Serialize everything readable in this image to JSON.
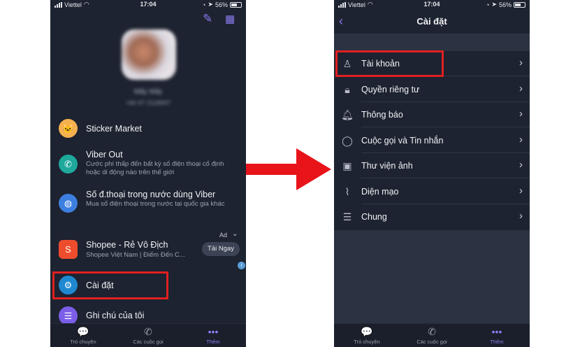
{
  "left_screen": {
    "status": {
      "carrier": "Viettel",
      "time": "17:04",
      "battery": "56%"
    },
    "blurred_name": "Mấy Mấy",
    "blurred_phone": "+84 97 2118997",
    "menu": [
      {
        "title": "Sticker Market",
        "subtitle": "",
        "icon": "cat-face-icon",
        "color": "#f5b14f"
      },
      {
        "title": "Viber Out",
        "subtitle": "Cước phí thấp đến bất kỳ số điện thoại cố định hoặc di động nào trên thế giới",
        "icon": "phone-out-icon",
        "color": "#1fa89c"
      },
      {
        "title": "Số đ.thoại trong nước dùng Viber",
        "subtitle": "Mua số điện thoại trong nước tại quốc gia khác",
        "icon": "globe-icon",
        "color": "#3d7fe0"
      }
    ],
    "ad": {
      "label": "Ad",
      "title": "Shopee - Rẻ Vô Địch",
      "subtitle": "Shopee Việt Nam | Điểm Đến C...",
      "cta": "Tải Ngay",
      "color": "#ee4d2d"
    },
    "settings_item": {
      "title": "Cài đặt",
      "icon": "gear-icon",
      "color": "#1e88d0"
    },
    "notes_item": {
      "title": "Ghi chú của tôi",
      "icon": "checklist-icon",
      "color": "#7b5ee8"
    },
    "tabs": [
      {
        "label": "Trò chuyện",
        "icon": "chat-bubble-icon"
      },
      {
        "label": "Các cuộc gọi",
        "icon": "phone-icon"
      },
      {
        "label": "Thêm",
        "icon": "more-dots-icon"
      }
    ]
  },
  "right_screen": {
    "status": {
      "carrier": "Viettel",
      "time": "17:04",
      "battery": "56%"
    },
    "title": "Cài đặt",
    "items": [
      {
        "label": "Tài khoản",
        "icon": "user-icon"
      },
      {
        "label": "Quyền riêng tư",
        "icon": "lock-icon"
      },
      {
        "label": "Thông báo",
        "icon": "bell-icon"
      },
      {
        "label": "Cuộc gọi và Tin nhắn",
        "icon": "chat-bubble-icon"
      },
      {
        "label": "Thư viện ảnh",
        "icon": "image-icon"
      },
      {
        "label": "Diện mạo",
        "icon": "brush-icon"
      },
      {
        "label": "Chung",
        "icon": "list-icon"
      }
    ],
    "tabs": [
      {
        "label": "Trò chuyện",
        "icon": "chat-bubble-icon"
      },
      {
        "label": "Các cuộc gọi",
        "icon": "phone-icon"
      },
      {
        "label": "Thêm",
        "icon": "more-dots-icon"
      }
    ]
  },
  "colors": {
    "accent": "#8b7cf3",
    "highlight_box": "#e02020",
    "arrow": "#e8141a",
    "background": "#1d2330"
  }
}
